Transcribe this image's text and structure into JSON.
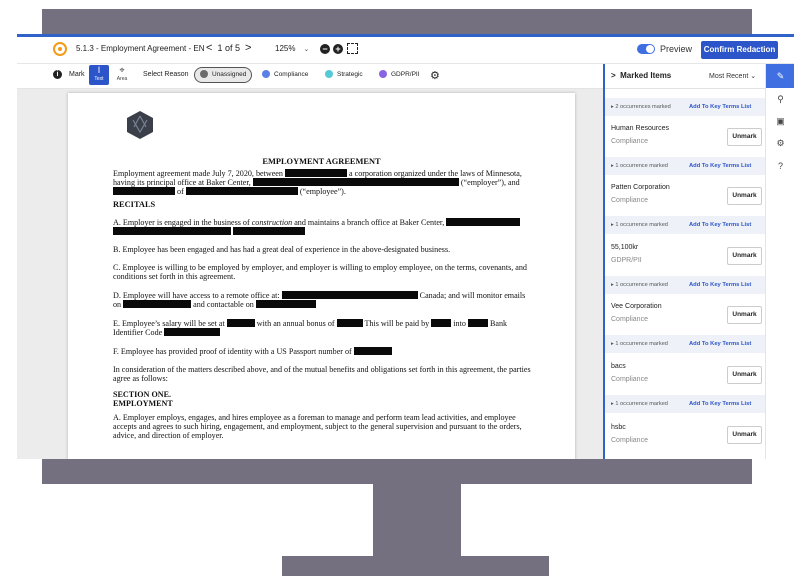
{
  "app": {
    "doc_title": "5.1.3 - Employment Agreement - EN",
    "pager": {
      "prev": "<",
      "current": "1",
      "of_label": "of 5",
      "next": ">"
    },
    "zoom": "125%",
    "zoom_caret": "⌄",
    "zoom_out": "−",
    "zoom_in": "+",
    "preview_label": "Preview",
    "preview_on": true,
    "confirm_label": "Confirm Redaction"
  },
  "toolbar": {
    "mark_label": "Mark",
    "text_tool": "Text",
    "area_tool": "Area",
    "select_reason": "Select Reason",
    "reasons": [
      {
        "label": "Unassigned",
        "color": "#6b6b6b"
      },
      {
        "label": "Compliance",
        "color": "#5a7fe6"
      },
      {
        "label": "Strategic",
        "color": "#56c9d6"
      },
      {
        "label": "GDPR/PII",
        "color": "#8a63e0"
      }
    ]
  },
  "document": {
    "heading": "EMPLOYMENT AGREEMENT",
    "intro_1": "Employment agreement made July 7, 2020, between",
    "intro_2": "a corporation organized under the laws of Minnesota,",
    "intro_3": "having its principal office at Baker Center,",
    "intro_4": "(“employer”), and",
    "intro_5": "of",
    "intro_6": "(“employee”).",
    "recitals": "RECITALS",
    "a_1": "A. Employer is engaged in the business of",
    "a_italic": "construction",
    "a_2": "and maintains a branch office at Baker Center,",
    "b": "B. Employee has been engaged and has had a great deal of experience in the above-designated business.",
    "c": "C. Employee is willing to be employed by employer, and employer is willing to employ employee, on the terms, covenants, and conditions set forth in this agreement.",
    "d_1": "D. Employee will have access to a remote office at:",
    "d_2": "Canada; and will monitor emails on",
    "d_3": "and contactable on",
    "e_1": "E. Employee’s salary will be set at",
    "e_2": "with an annual bonus of",
    "e_3": "This will be paid by",
    "e_4": "into",
    "e_5": "Bank Identifier Code",
    "f": "F. Employee has provided proof of identity with a US Passport number of",
    "consideration": "In consideration of the matters described above, and of the mutual benefits and obligations set forth in this agreement, the parties agree as follows:",
    "section_one": "SECTION ONE.",
    "employment": "EMPLOYMENT",
    "sa": "A. Employer employs, engages, and hires employee as a foreman to manage and perform team lead activities, and employee accepts and agrees to such hiring, engagement, and employment, subject to the general supervision and pursuant to the orders, advice, and direction of employer."
  },
  "panel": {
    "title": "Marked Items",
    "sort": "Most Recent",
    "add_label": "Add To Key Terms List",
    "unmark_label": "Unmark",
    "first_occurrence": "2 occurrences marked",
    "items": [
      {
        "name": "Human Resources",
        "category": "Compliance",
        "occurrences": "1 occurrence marked"
      },
      {
        "name": "Patten Corporation",
        "category": "Compliance",
        "occurrences": "1 occurrence marked"
      },
      {
        "name": "55,100kr",
        "category": "GDPR/PII",
        "occurrences": "1 occurrence marked"
      },
      {
        "name": "Vee Corporation",
        "category": "Compliance",
        "occurrences": "1 occurrence marked"
      },
      {
        "name": "bacs",
        "category": "Compliance",
        "occurrences": "1 occurrence marked"
      },
      {
        "name": "hsbc",
        "category": "Compliance",
        "occurrences": ""
      }
    ]
  },
  "rail": {
    "icons": [
      "marker-icon",
      "search-icon",
      "document-icon",
      "gear-icon",
      "help-icon"
    ],
    "help_label": "?"
  }
}
